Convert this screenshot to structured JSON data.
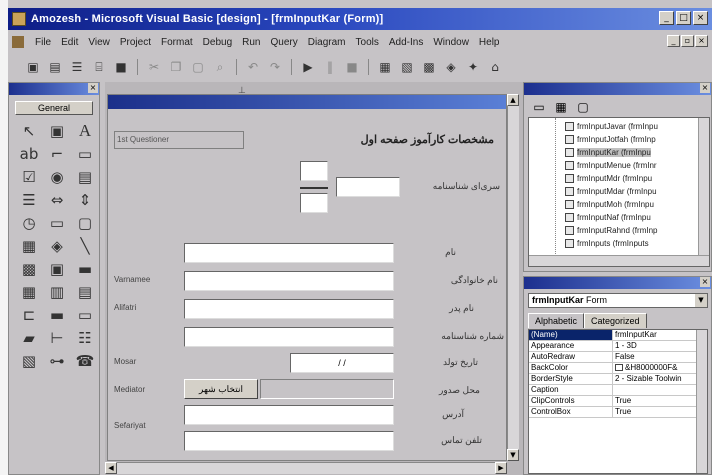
{
  "window": {
    "title": "Amozesh - Microsoft Visual Basic [design] - [frmInputKar (Form)]",
    "buttons": {
      "minimize": "_",
      "maximize": "□",
      "close": "×"
    }
  },
  "menu": {
    "items": [
      "File",
      "Edit",
      "View",
      "Project",
      "Format",
      "Debug",
      "Run",
      "Query",
      "Diagram",
      "Tools",
      "Add-Ins",
      "Window",
      "Help"
    ],
    "mdi_buttons": {
      "minimize": "_",
      "restore": "▫",
      "close": "×"
    }
  },
  "toolbar": {
    "icons": [
      "add-project-icon",
      "add-form-icon",
      "menu-editor-icon",
      "open-icon",
      "save-icon",
      "cut-icon",
      "copy-icon",
      "paste-icon",
      "find-icon",
      "undo-icon",
      "redo-icon",
      "start-icon",
      "break-icon",
      "end-icon",
      "project-explorer-icon",
      "properties-icon",
      "form-layout-icon",
      "object-browser-icon",
      "toolbox-icon",
      "data-view-icon"
    ]
  },
  "toolbox": {
    "tab_label": "General",
    "tools": [
      "pointer-icon",
      "picturebox-icon",
      "label-icon",
      "textbox-icon",
      "frame-icon",
      "commandbutton-icon",
      "checkbox-icon",
      "optionbutton-icon",
      "combobox-icon",
      "listbox-icon",
      "hscrollbar-icon",
      "vscrollbar-icon",
      "timer-icon",
      "drivelistbox-icon",
      "dirlistbox-icon",
      "filelistbox-icon",
      "shape-icon",
      "line-icon",
      "image-icon",
      "data-icon",
      "ole-icon",
      "grid-icon",
      "chart-icon",
      "datagrid-icon",
      "tabstrip-icon",
      "toolbar-icon",
      "statusbar-icon",
      "progressbar-icon",
      "treeview-icon",
      "listview-icon",
      "imagelist-icon",
      "slider-icon",
      "mscomm-icon"
    ]
  },
  "form": {
    "frame_caption": "1st Questioner",
    "heading": "مشخصات کارآموز صفحه اول",
    "fields": {
      "serial_label": "سری‌ای شناسنامه",
      "name_label": "نام",
      "family_label": "نام خانوادگی",
      "father_label": "نام پدر",
      "idnum_label": "شماره شناسنامه",
      "birthdate_label": "تاریخ تولد",
      "birthplace_label": "محل صدور",
      "address_label": "آدرس",
      "phone_label": "تلفن تماس",
      "birthdate_sep": "/    /"
    },
    "left_labels": {
      "l1": "Varnamee",
      "l2": "Alifatri",
      "l3": "Mosar",
      "l4": "Mediator",
      "l5": "Sefariyat"
    },
    "city_button": "انتخاب شهر",
    "ruler_mark": "⊥"
  },
  "project": {
    "items": [
      {
        "name": "frmInputJavar (frmInpu"
      },
      {
        "name": "frmInputJotfah (frmInp"
      },
      {
        "name": "frmInputKar (frmInpu",
        "selected": true
      },
      {
        "name": "frmInputMenue (frmInr"
      },
      {
        "name": "frmInputMdr (frmInpu"
      },
      {
        "name": "frmInputMdar (frmInpu"
      },
      {
        "name": "frmInputMoh (frmInpu"
      },
      {
        "name": "frmInputNaf (frmInpu"
      },
      {
        "name": "frmInputRahnd (frmInp"
      },
      {
        "name": "frmInputs (frmInputs"
      }
    ]
  },
  "properties": {
    "object": "frmInputKar",
    "object_type": "Form",
    "tabs": [
      "Alphabetic",
      "Categorized"
    ],
    "rows": [
      {
        "name": "(Name)",
        "value": "frmInputKar",
        "selected": true
      },
      {
        "name": "Appearance",
        "value": "1 - 3D"
      },
      {
        "name": "AutoRedraw",
        "value": "False"
      },
      {
        "name": "BackColor",
        "value": "&H8000000F&"
      },
      {
        "name": "BorderStyle",
        "value": "2 - Sizable Toolwin"
      },
      {
        "name": "Caption",
        "value": ""
      },
      {
        "name": "ClipControls",
        "value": "True"
      },
      {
        "name": "ControlBox",
        "value": "True"
      }
    ]
  }
}
